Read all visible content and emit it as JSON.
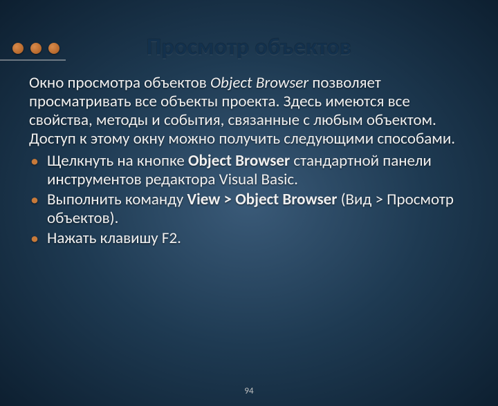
{
  "title": "Просмотр объектов",
  "intro": {
    "prefix": "Окно просмотра объектов ",
    "italic": "Object Browser",
    "suffix": " позволяет просматривать все объекты проекта. Здесь имеются все свойства, методы и события, связанные с любым объектом. Доступ к этому окну можно получить следующими способами."
  },
  "bullets": [
    {
      "before": "Щелкнуть на кнопке ",
      "bold": "Object Browser",
      "after": " стандартной панели инструментов редактора Visual Basic."
    },
    {
      "before": "Выполнить команду ",
      "bold": "View > Object Browser",
      "after": " (Вид > Просмотр объектов)."
    },
    {
      "before": "Нажать клавишу F2.",
      "bold": "",
      "after": ""
    }
  ],
  "page_number": "94"
}
